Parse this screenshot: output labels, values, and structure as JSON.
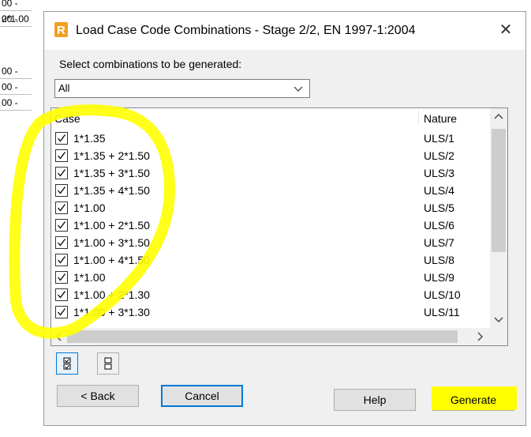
{
  "background_app": {
    "cells": [
      "00 -   2*1.00",
      "00 -",
      "00 -",
      "00 -",
      "00 -"
    ]
  },
  "dialog": {
    "title": "Load Case Code Combinations - Stage 2/2, EN 1997-1:2004",
    "close_label": "✕",
    "prompt": "Select combinations to be generated:",
    "filter": {
      "selected": "All"
    },
    "list": {
      "headers": {
        "case": "Case",
        "nature": "Nature"
      },
      "rows": [
        {
          "case": "1*1.35",
          "nature": "ULS/1",
          "checked": true
        },
        {
          "case": "1*1.35 + 2*1.50",
          "nature": "ULS/2",
          "checked": true
        },
        {
          "case": "1*1.35 + 3*1.50",
          "nature": "ULS/3",
          "checked": true
        },
        {
          "case": "1*1.35 + 4*1.50",
          "nature": "ULS/4",
          "checked": true
        },
        {
          "case": "1*1.00",
          "nature": "ULS/5",
          "checked": true
        },
        {
          "case": "1*1.00 + 2*1.50",
          "nature": "ULS/6",
          "checked": true
        },
        {
          "case": "1*1.00 + 3*1.50",
          "nature": "ULS/7",
          "checked": true
        },
        {
          "case": "1*1.00 + 4*1.50",
          "nature": "ULS/8",
          "checked": true
        },
        {
          "case": "1*1.00",
          "nature": "ULS/9",
          "checked": true
        },
        {
          "case": "1*1.00 + 2*1.30",
          "nature": "ULS/10",
          "checked": true
        },
        {
          "case": "1*1.00 + 3*1.30",
          "nature": "ULS/11",
          "checked": true
        }
      ]
    },
    "buttons": {
      "back": "< Back",
      "cancel": "Cancel",
      "help": "Help",
      "generate": "Generate"
    },
    "colors": {
      "accent": "#0078d7",
      "highlight": "#ffff00",
      "app_icon": "#f0a020"
    }
  }
}
